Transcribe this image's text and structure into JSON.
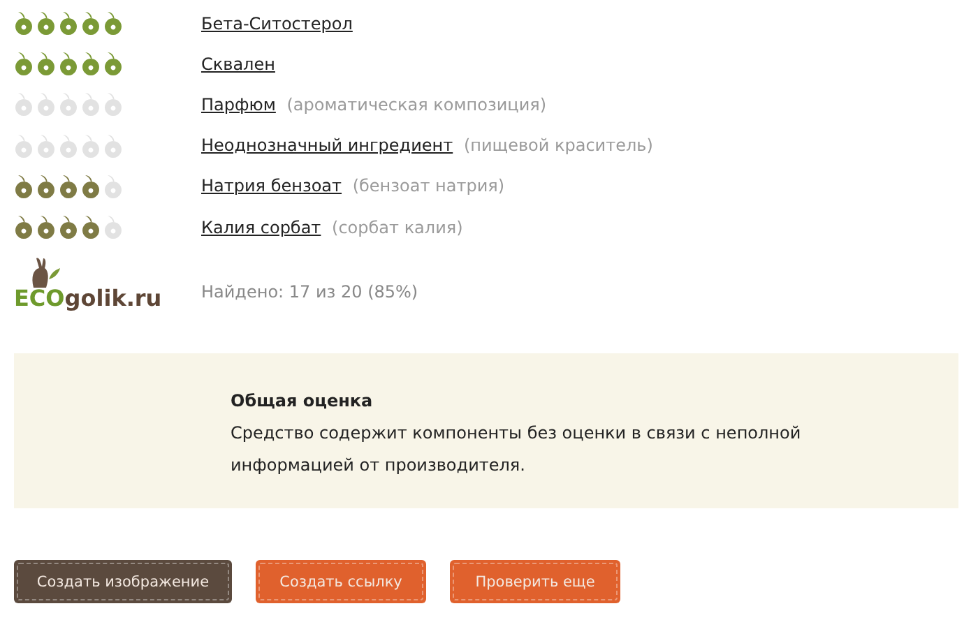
{
  "ingredients": [
    {
      "stars": 5,
      "color": "#7b9a36",
      "name": "Бета-Ситостерол"
    },
    {
      "stars": 5,
      "color": "#7b9a36",
      "name": "Сквален"
    },
    {
      "stars": 0,
      "name": "Парфюм",
      "note": "(ароматическая композиция)"
    },
    {
      "stars": 0,
      "name": "Неоднозначный ингредиент",
      "note": "(пищевой краситель)"
    },
    {
      "stars": 4,
      "color": "#7f7b45",
      "name": "Натрия бензоат",
      "note": "(бензоат натрия)"
    },
    {
      "stars": 4,
      "color": "#7f7b45",
      "name": "Калия сорбат",
      "note": "(сорбат калия)"
    }
  ],
  "logo": {
    "eco": "ECO",
    "rest": "golik.ru"
  },
  "found": "Найдено: 17 из 20 (85%)",
  "summary": {
    "title": "Общая оценка",
    "text": "Средство содержит компоненты без оценки в связи с неполной информацией от производителя."
  },
  "buttons": [
    {
      "kind": "dark",
      "label": "Создать изображение"
    },
    {
      "kind": "orange",
      "label": "Создать ссылку"
    },
    {
      "kind": "orange",
      "label": "Проверить еще"
    }
  ]
}
